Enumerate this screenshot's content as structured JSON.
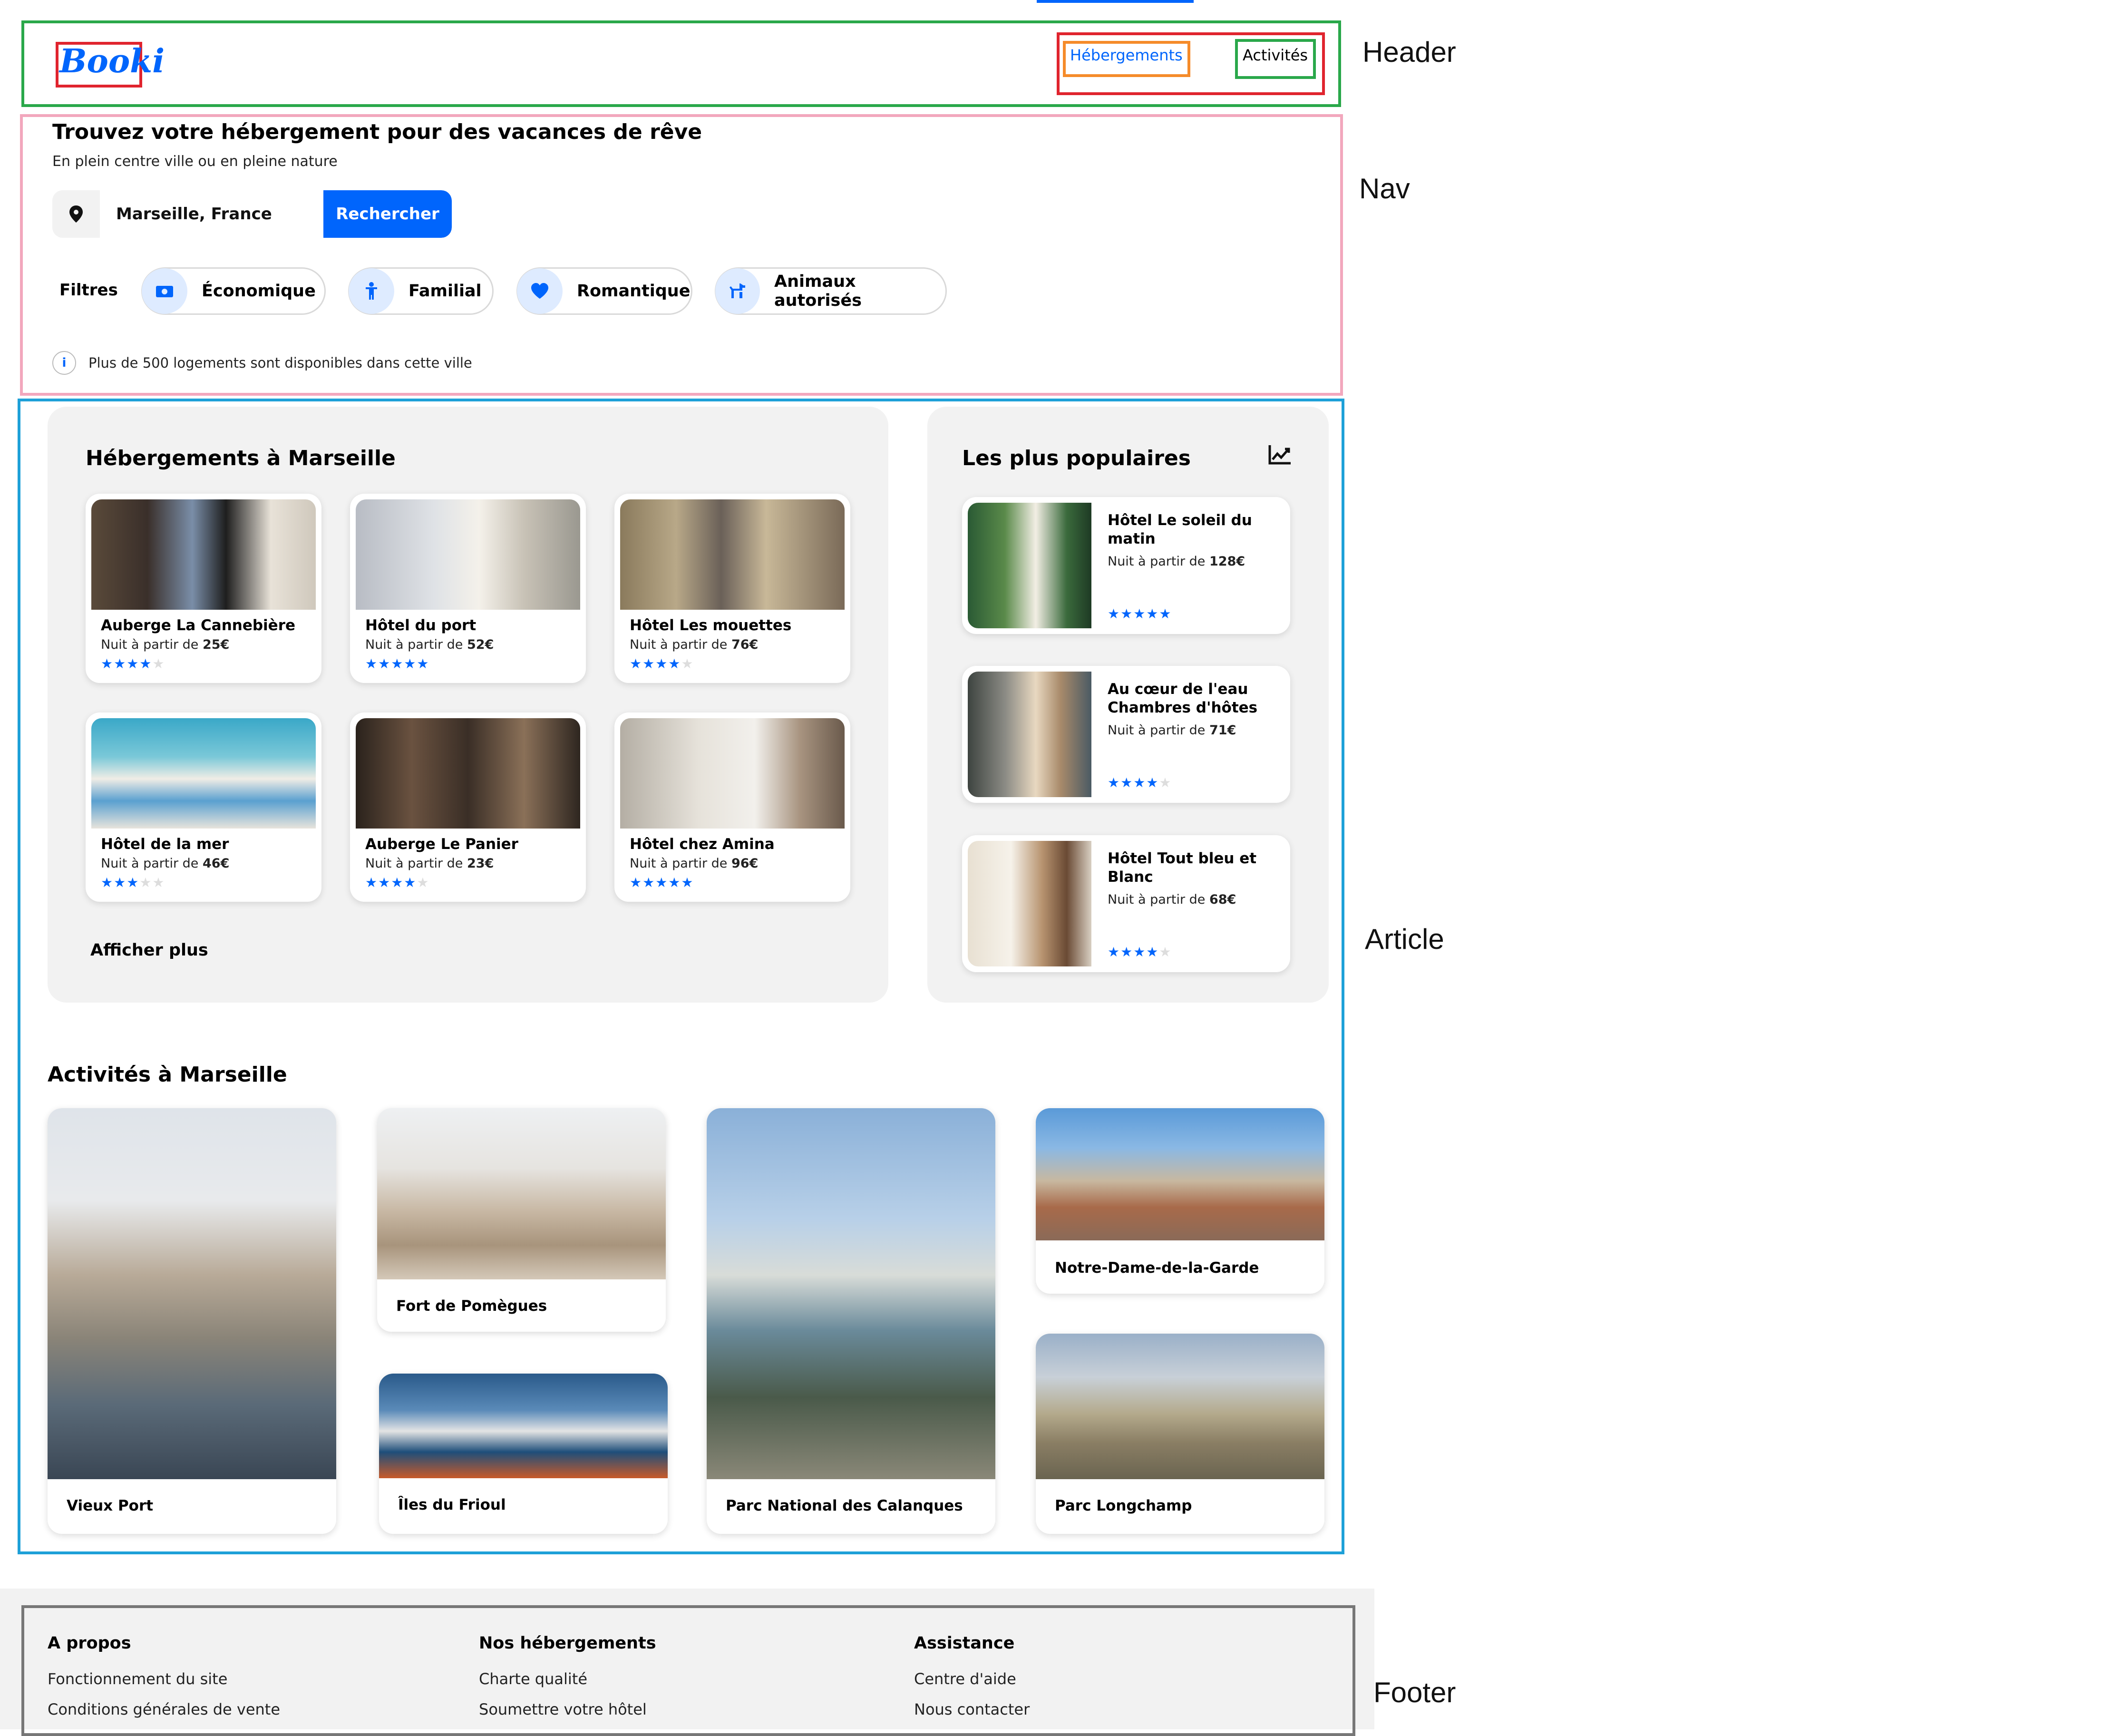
{
  "annotations": {
    "header": "Header",
    "nav": "Nav",
    "article": "Article",
    "footer": "Footer"
  },
  "header": {
    "logo": "Booki",
    "links": [
      "Hébergements",
      "Activités"
    ]
  },
  "nav": {
    "title": "Trouvez votre hébergement pour des vacances de rêve",
    "subtitle": "En plein centre ville ou en pleine nature",
    "search_value": "Marseille, France",
    "search_button": "Rechercher",
    "filters_label": "Filtres",
    "filters": [
      {
        "label": "Économique",
        "icon": "money-icon"
      },
      {
        "label": "Familial",
        "icon": "child-icon"
      },
      {
        "label": "Romantique",
        "icon": "heart-icon"
      },
      {
        "label": "Animaux autorisés",
        "icon": "dog-icon"
      }
    ],
    "info": "Plus de 500 logements sont disponibles dans cette ville"
  },
  "hebergements": {
    "title": "Hébergements à Marseille",
    "price_prefix": "Nuit à partir de",
    "items": [
      {
        "name": "Auberge La Cannebière",
        "price": "25€",
        "rating": 4
      },
      {
        "name": "Hôtel du port",
        "price": "52€",
        "rating": 5
      },
      {
        "name": "Hôtel Les mouettes",
        "price": "76€",
        "rating": 4
      },
      {
        "name": "Hôtel de la mer",
        "price": "46€",
        "rating": 3
      },
      {
        "name": "Auberge Le Panier",
        "price": "23€",
        "rating": 4
      },
      {
        "name": "Hôtel chez Amina",
        "price": "96€",
        "rating": 5
      }
    ],
    "more": "Afficher plus"
  },
  "populaires": {
    "title": "Les plus populaires",
    "icon": "trend-chart-icon",
    "items": [
      {
        "name_l1": "Hôtel Le soleil du",
        "name_l2": "matin",
        "price": "128€",
        "rating": 5
      },
      {
        "name_l1": "Au cœur de l'eau",
        "name_l2": "Chambres d'hôtes",
        "price": "71€",
        "rating": 4
      },
      {
        "name_l1": "Hôtel Tout bleu et",
        "name_l2": "Blanc",
        "price": "68€",
        "rating": 4
      }
    ]
  },
  "activites": {
    "title": "Activités à Marseille",
    "items": [
      "Vieux Port",
      "Fort de Pomègues",
      "Îles du Frioul",
      "Parc National des Calanques",
      "Notre-Dame-de-la-Garde",
      "Parc Longchamp"
    ]
  },
  "footer": {
    "cols": [
      {
        "title": "A propos",
        "links": [
          "Fonctionnement du site",
          "Conditions générales de vente"
        ]
      },
      {
        "title": "Nos hébergements",
        "links": [
          "Charte qualité",
          "Soumettre votre hôtel"
        ]
      },
      {
        "title": "Assistance",
        "links": [
          "Centre d'aide",
          "Nous contacter"
        ]
      }
    ]
  },
  "colors": {
    "accent": "#0065fc",
    "panel": "#f2f2f2"
  }
}
